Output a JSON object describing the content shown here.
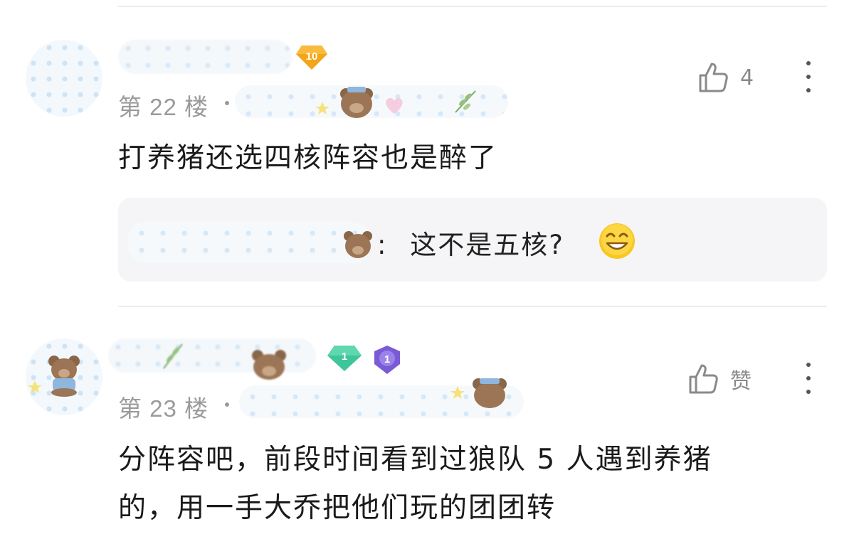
{
  "comments": [
    {
      "floor": "第 22 楼",
      "level_badge": "10",
      "text": "打养猪还选四核阵容也是醉了",
      "like_label": "4",
      "reply": {
        "separator": ":",
        "text": "这不是五核?"
      }
    },
    {
      "floor": "第 23 楼",
      "level_badge": "1",
      "second_badge": "1",
      "text_line1": "分阵容吧，前段时间看到过狼队 5 人遇到养猪",
      "text_line2": "的，用一手大乔把他们玩的团团转",
      "like_label": "赞"
    }
  ],
  "colors": {
    "badge_orange": "#f3a619",
    "badge_green": "#3ec59a",
    "badge_purple": "#7a5bd6",
    "reply_bg": "#f5f5f7",
    "muted_text": "#9a9a9a"
  },
  "icons": [
    "thumbs-up-icon",
    "more-vertical-icon",
    "grin-emoji-icon",
    "bear-sticker-icon"
  ]
}
